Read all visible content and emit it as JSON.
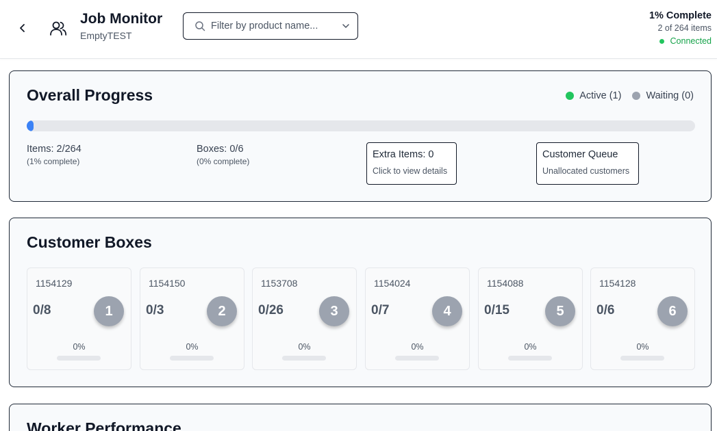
{
  "header": {
    "title": "Job Monitor",
    "subtitle": "EmptyTEST",
    "search_placeholder": "Filter by product name...",
    "complete_text": "1% Complete",
    "items_text": "2 of 264 items",
    "connection_text": "Connected"
  },
  "overall": {
    "title": "Overall Progress",
    "progress_fraction": 0.0076,
    "active_label": "Active (1)",
    "waiting_label": "Waiting (0)",
    "items_label": "Items: 2/264",
    "items_sub": "(1% complete)",
    "boxes_label": "Boxes: 0/6",
    "boxes_sub": "(0% complete)",
    "extra_label": "Extra Items: 0",
    "extra_sub": "Click to view details",
    "queue_label": "Customer Queue",
    "queue_sub": "Unallocated customers"
  },
  "customer_boxes": {
    "title": "Customer Boxes",
    "boxes": [
      {
        "id": "1154129",
        "count": "0/8",
        "number": "1",
        "percent": "0%"
      },
      {
        "id": "1154150",
        "count": "0/3",
        "number": "2",
        "percent": "0%"
      },
      {
        "id": "1153708",
        "count": "0/26",
        "number": "3",
        "percent": "0%"
      },
      {
        "id": "1154024",
        "count": "0/7",
        "number": "4",
        "percent": "0%"
      },
      {
        "id": "1154088",
        "count": "0/15",
        "number": "5",
        "percent": "0%"
      },
      {
        "id": "1154128",
        "count": "0/6",
        "number": "6",
        "percent": "0%"
      }
    ]
  },
  "worker": {
    "title": "Worker Performance"
  },
  "colors": {
    "progress": "#3b82f6",
    "active": "#22c55e",
    "waiting": "#9ca3af",
    "connected": "#16a34a"
  },
  "icons": [
    "chevron-left-icon",
    "users-icon",
    "search-icon",
    "chevron-down-icon",
    "status-dot-icon"
  ]
}
